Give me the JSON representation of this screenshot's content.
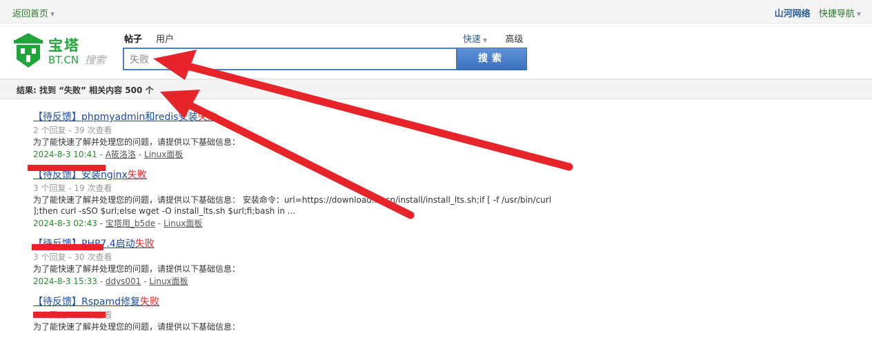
{
  "topbar": {
    "home_label": "返回首页",
    "site_name": "山河网络",
    "quick_nav_label": "快捷导航"
  },
  "logo": {
    "name": "宝塔",
    "domain": "BT.CN",
    "search_word": "搜索"
  },
  "search": {
    "tabs": [
      {
        "label": "帖子",
        "active": true
      },
      {
        "label": "用户",
        "active": false
      }
    ],
    "quick_label": "快速",
    "advanced_label": "高级",
    "query": "失败",
    "button_label": "搜索"
  },
  "result_summary": "结果: 找到 “失败” 相关内容 500 个",
  "results": [
    {
      "title_prefix": "【待反馈】phpmyadmin和redis安装",
      "title_highlight": "失败",
      "meta": "2 个回复 - 39 次查看",
      "description": "为了能快速了解并处理您的问题，请提供以下基础信息：",
      "date": "2024-8-3 10:41",
      "author": "A筱洛洛",
      "board": "Linux面板"
    },
    {
      "title_prefix": "【待反馈】安装nginx",
      "title_highlight": "失败",
      "meta": "3 个回复 - 19 次查看",
      "description": "为了能快速了解并处理您的问题，请提供以下基础信息： 安装命令：url=https://download.bt.cn/install/install_lts.sh;if [ -f /usr/bin/curl ];then curl -sSO $url;else wget -O install_lts.sh $url;fi;bash in ...",
      "date": "2024-8-3 02:43",
      "author": "宝塔用_b5de",
      "board": "Linux面板"
    },
    {
      "title_prefix": "【待反馈】PHP7.4启动",
      "title_highlight": "失败",
      "meta": "3 个回复 - 30 次查看",
      "description": "为了能快速了解并处理您的问题，请提供以下基础信息：",
      "date": "2024-8-3 15:33",
      "author": "ddys001",
      "board": "Linux面板"
    },
    {
      "title_prefix": "【待反馈】Rspamd修复",
      "title_highlight": "失败",
      "meta": "9 个回复 - 46 次查看",
      "description": "为了能快速了解并处理您的问题，请提供以下基础信息：",
      "date": "",
      "author": "",
      "board": ""
    }
  ],
  "separator": " - ",
  "colors": {
    "brand_green": "#20a53a",
    "link_blue": "#1a4aa8",
    "highlight_red": "#d42b2b",
    "annotation_red": "#e8242b"
  }
}
